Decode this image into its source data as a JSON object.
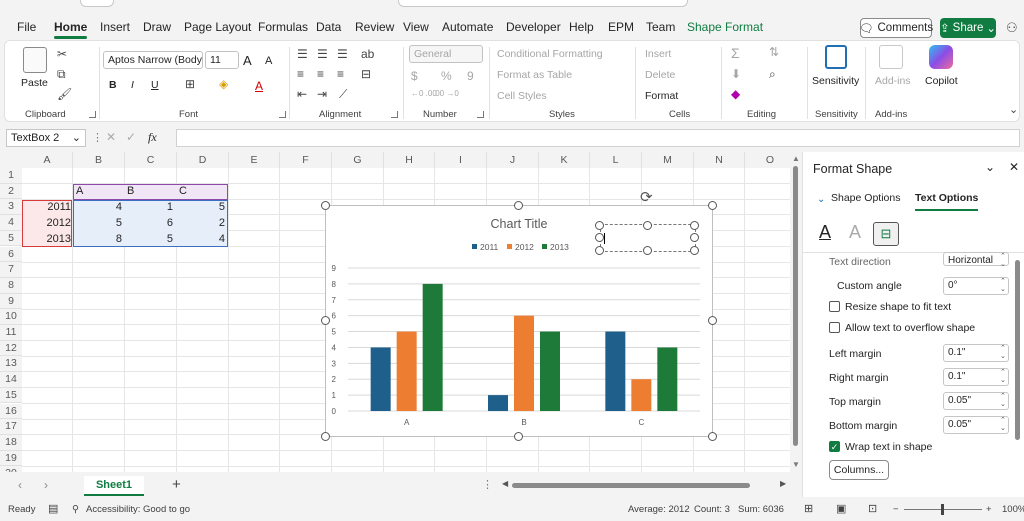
{
  "tabs": [
    "File",
    "Home",
    "Insert",
    "Draw",
    "Page Layout",
    "Formulas",
    "Data",
    "Review",
    "View",
    "Automate",
    "Developer",
    "Help",
    "EPM",
    "Team",
    "Shape Format"
  ],
  "topright": {
    "comments": "Comments",
    "share": "Share"
  },
  "ribbon": {
    "clipboard": {
      "paste": "Paste",
      "label": "Clipboard"
    },
    "font": {
      "name": "Aptos Narrow (Body",
      "size": "11",
      "grow": "A",
      "shrink": "A",
      "bold": "B",
      "italic": "I",
      "underline": "U",
      "fontcolor": "A",
      "label": "Font"
    },
    "alignment": {
      "label": "Alignment"
    },
    "number": {
      "format": "General",
      "currency": "$",
      "percent": "%",
      "comma": "9",
      "inc_dec": "←0 .00",
      "dec_dec": ".00 →0",
      "label": "Number"
    },
    "styles": {
      "cond": "Conditional Formatting",
      "table": "Format as Table",
      "cell": "Cell Styles",
      "label": "Styles"
    },
    "cells": {
      "insert": "Insert",
      "delete": "Delete",
      "format": "Format",
      "label": "Cells"
    },
    "editing": {
      "label": "Editing"
    },
    "sensitivity": {
      "name": "Sensitivity",
      "label": "Sensitivity"
    },
    "addins": {
      "name": "Add-ins",
      "label": "Add-ins"
    },
    "copilot": {
      "name": "Copilot"
    }
  },
  "formulabar": {
    "namebox": "TextBox 2",
    "fx": "fx"
  },
  "sheet": {
    "columns": [
      "A",
      "B",
      "C",
      "D",
      "E",
      "F",
      "G",
      "H",
      "I",
      "J",
      "K",
      "L",
      "M",
      "N",
      "O"
    ],
    "rows": [
      "1",
      "2",
      "3",
      "4",
      "5",
      "6",
      "7",
      "8",
      "9",
      "10",
      "11",
      "12",
      "13",
      "14",
      "15",
      "16",
      "17",
      "18",
      "19",
      "20"
    ],
    "header_row": [
      "A",
      "B",
      "C"
    ],
    "data": [
      {
        "year": "2011",
        "a": "4",
        "b": "1",
        "c": "5"
      },
      {
        "year": "2012",
        "a": "5",
        "b": "6",
        "c": "2"
      },
      {
        "year": "2013",
        "a": "8",
        "b": "5",
        "c": "4"
      }
    ]
  },
  "chart_data": {
    "type": "bar",
    "title": "Chart Title",
    "categories": [
      "A",
      "B",
      "C"
    ],
    "series": [
      {
        "name": "2011",
        "values": [
          4,
          1,
          5
        ],
        "color": "#1f5f8b"
      },
      {
        "name": "2012",
        "values": [
          5,
          6,
          2
        ],
        "color": "#ed7d31"
      },
      {
        "name": "2013",
        "values": [
          8,
          5,
          4
        ],
        "color": "#1e7a38"
      }
    ],
    "ylim": [
      0,
      9
    ],
    "yticks": [
      "0",
      "1",
      "2",
      "3",
      "4",
      "5",
      "6",
      "7",
      "8",
      "9"
    ],
    "legend": "top",
    "grid": true
  },
  "sheettabs": {
    "active": "Sheet1",
    "add": "+"
  },
  "status": {
    "ready": "Ready",
    "accessibility": "Accessibility: Good to go",
    "average": "Average: 2012",
    "count": "Count: 3",
    "sum": "Sum: 6036",
    "zoom": "100%"
  },
  "pane": {
    "title": "Format Shape",
    "tab_shape": "Shape Options",
    "tab_text": "Text Options",
    "text_direction_label": "Text direction",
    "text_direction_value": "Horizontal",
    "custom_angle_label": "Custom angle",
    "custom_angle_value": "0°",
    "resize": "Resize shape to fit text",
    "overflow": "Allow text to overflow shape",
    "left_margin_label": "Left margin",
    "left_margin": "0.1\"",
    "right_margin_label": "Right margin",
    "right_margin": "0.1\"",
    "top_margin_label": "Top margin",
    "top_margin": "0.05\"",
    "bottom_margin_label": "Bottom margin",
    "bottom_margin": "0.05\"",
    "wrap": "Wrap text in shape",
    "columns": "Columns..."
  }
}
